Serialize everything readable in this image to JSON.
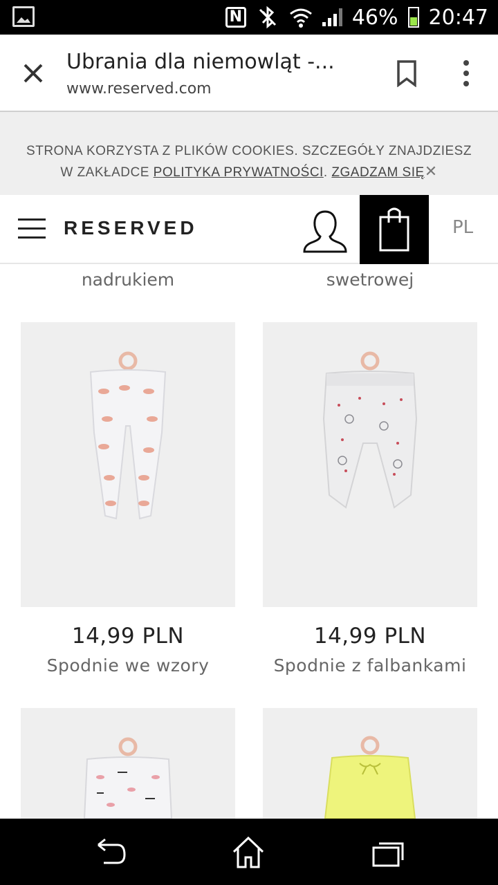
{
  "status_bar": {
    "battery": "46%",
    "time": "20:47"
  },
  "browser": {
    "title": "Ubrania dla niemowląt -...",
    "url": "www.reserved.com"
  },
  "cookie_banner": {
    "text_before": "STRONA KORZYSTA Z PLIKÓW COOKIES. SZCZEGÓŁY ZNAJDZIESZ W ZAKŁADCE ",
    "privacy_link": "POLITYKA PRYWATNOŚCI",
    "separator": ". ",
    "accept_link": "ZGADZAM SIĘ",
    "close_symbol": "✕"
  },
  "header": {
    "logo": "RESERVED",
    "language": "PL"
  },
  "products": {
    "cut_off": [
      {
        "name_fragment": "nadrukiem"
      },
      {
        "name_fragment": "swetrowej"
      }
    ],
    "items": [
      {
        "price": "14,99 PLN",
        "name": "Spodnie we wzory",
        "color": "#efefef"
      },
      {
        "price": "14,99 PLN",
        "name": "Spodnie z falbankami",
        "color": "#efefef"
      },
      {
        "price": "",
        "name": "",
        "color": "#efefef"
      },
      {
        "price": "",
        "name": "",
        "color": "#efefef"
      }
    ]
  },
  "colors": {
    "bag_bg": "#000000",
    "page_bg": "#ffffff",
    "banner_bg": "#efefef"
  }
}
